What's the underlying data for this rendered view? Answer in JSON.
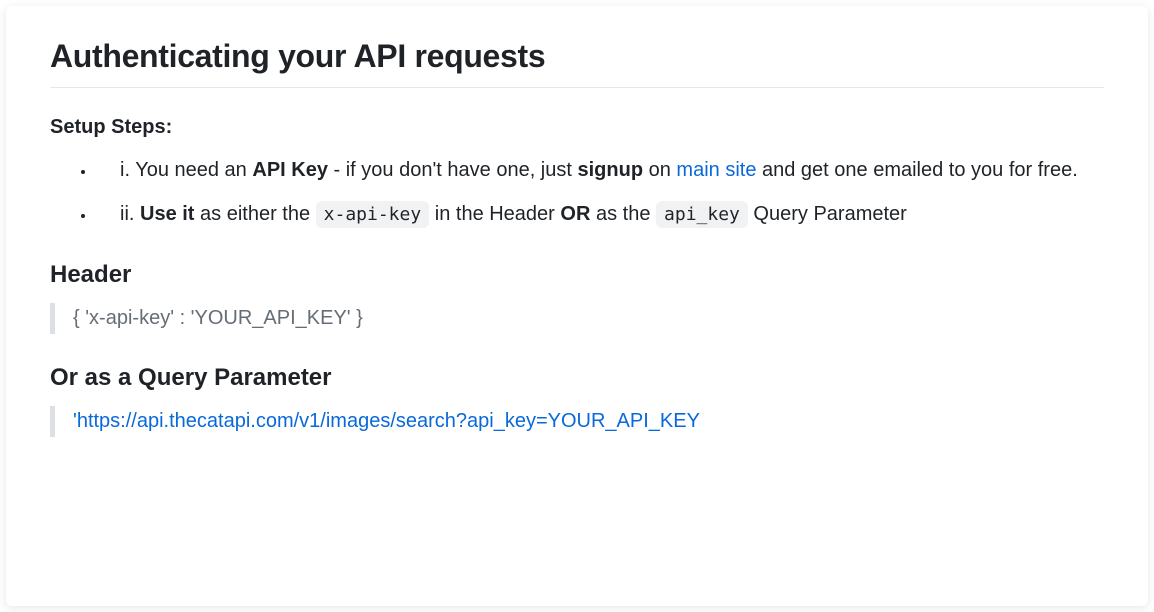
{
  "title": "Authenticating your API requests",
  "setup": {
    "heading": "Setup Steps:",
    "items": [
      {
        "prefix": "i. ",
        "t1": "You need an ",
        "bold1": "API Key",
        "t2": " - if you don't have one, just ",
        "bold2": "signup",
        "t3": " on ",
        "link_text": "main site",
        "t4": " and get one emailed to you for free."
      },
      {
        "prefix": "ii. ",
        "bold1": "Use it",
        "t1": " as either the ",
        "code1": "x-api-key",
        "t2": " in the Header ",
        "bold2": "OR",
        "t3": " as the ",
        "code2": "api_key",
        "t4": " Query Parameter"
      }
    ]
  },
  "header_section": {
    "heading": "Header",
    "code": "{ 'x-api-key' : 'YOUR_API_KEY' }"
  },
  "query_section": {
    "heading": "Or as a Query Parameter",
    "code": "'https://api.thecatapi.com/v1/images/search?api_key=YOUR_API_KEY"
  }
}
